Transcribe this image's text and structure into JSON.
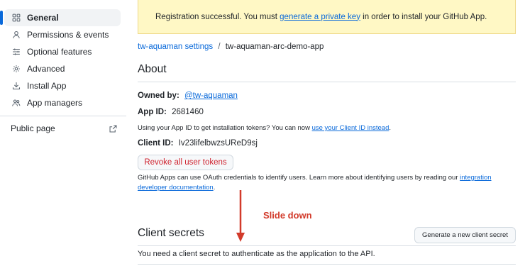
{
  "sidebar": {
    "items": [
      {
        "label": "General",
        "icon": "grid-icon",
        "active": true
      },
      {
        "label": "Permissions & events",
        "icon": "key-icon",
        "active": false
      },
      {
        "label": "Optional features",
        "icon": "sliders-icon",
        "active": false
      },
      {
        "label": "Advanced",
        "icon": "gear-icon",
        "active": false
      },
      {
        "label": "Install App",
        "icon": "download-icon",
        "active": false
      },
      {
        "label": "App managers",
        "icon": "people-icon",
        "active": false
      }
    ],
    "public_page": {
      "label": "Public page",
      "icon": "external-link-icon"
    }
  },
  "flash": {
    "prefix": "Registration successful. You must ",
    "link": "generate a private key",
    "suffix": " in order to install your GitHub App."
  },
  "breadcrumb": {
    "parent": "tw-aquaman settings",
    "separator": "/",
    "current": "tw-aquaman-arc-demo-app"
  },
  "about": {
    "title": "About",
    "owned_by_label": "Owned by:",
    "owned_by_value": "@tw-aquaman",
    "app_id_label": "App ID:",
    "app_id_value": "2681460",
    "app_id_note_prefix": "Using your App ID to get installation tokens? You can now ",
    "app_id_note_link": "use your Client ID instead",
    "app_id_note_suffix": ".",
    "client_id_label": "Client ID:",
    "client_id_value": "Iv23lifelbwzsUReD9sj",
    "revoke_button": "Revoke all user tokens",
    "oauth_note_prefix": "GitHub Apps can use OAuth credentials to identify users. Learn more about identifying users by reading our ",
    "oauth_note_link_1": "integration",
    "oauth_note_link_2": "developer documentation",
    "oauth_note_suffix": "."
  },
  "annotation": {
    "text": "Slide down",
    "color": "#d23a2a"
  },
  "client_secrets": {
    "title": "Client secrets",
    "generate_button": "Generate a new client secret",
    "description": "You need a client secret to authenticate as the application to the API."
  },
  "colors": {
    "link": "#0969da",
    "danger": "#cf222e",
    "flash_bg": "#fff8c5",
    "active_indicator": "#0969da"
  }
}
